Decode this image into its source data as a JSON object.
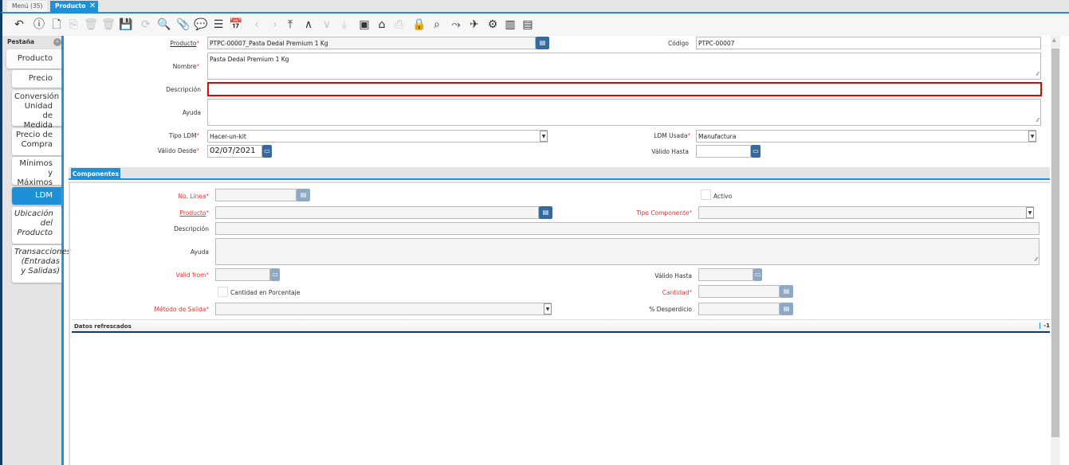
{
  "window_tabs": {
    "menu": "Menú (35)",
    "active": "Producto"
  },
  "toolbar": [
    "undo-icon",
    "help-icon",
    "new-record-icon",
    "copy-record-icon",
    "delete-icon",
    "delete-selection-icon",
    "save-icon",
    "refresh-icon",
    "find-icon",
    "attachment-icon",
    "chat-icon",
    "grid-toggle-icon",
    "calendar-icon",
    "previous-icon",
    "next-icon",
    "first-record-icon",
    "parent-record-icon",
    "detail-record-icon",
    "last-record-icon",
    "report-icon",
    "archive-icon",
    "print-icon",
    "lock-icon",
    "zoom-across-icon",
    "workflow-icon",
    "request-icon",
    "process-icon",
    "product-info-icon",
    "form-icon"
  ],
  "sidebar": {
    "title": "Pestaña",
    "tabs": [
      "Producto",
      "Precio",
      "Conversión Unidad de Medida",
      "Precio de Compra",
      "Mínimos y Máximos",
      "LDM",
      "Ubicación del Producto",
      "Transacciones (Entradas y Salidas)"
    ],
    "active": "LDM"
  },
  "header_form": {
    "producto": {
      "label": "Producto",
      "value": "PTPC-00007_Pasta Dedal Premium 1 Kg"
    },
    "codigo": {
      "label": "Código",
      "value": "PTPC-00007"
    },
    "nombre": {
      "label": "Nombre",
      "value": "Pasta Dedal Premium 1 Kg"
    },
    "descripcion": {
      "label": "Descripción",
      "value": ""
    },
    "ayuda": {
      "label": "Ayuda",
      "value": ""
    },
    "tipo_ldm": {
      "label": "Tipo LDM",
      "value": "Hacer-un-kit"
    },
    "ldm_usada": {
      "label": "LDM Usada",
      "value": "Manufactura"
    },
    "valido_desde": {
      "label": "Válido Desde",
      "value": "02/07/2021"
    },
    "valido_hasta": {
      "label": "Válido Hasta",
      "value": ""
    }
  },
  "subtab": {
    "label": "Componentes"
  },
  "components_form": {
    "no_linea": {
      "label": "No. Línea",
      "value": ""
    },
    "activo": {
      "label": "Activo",
      "checked": false
    },
    "producto": {
      "label": "Producto",
      "value": ""
    },
    "tipo_componente": {
      "label": "Tipo Componente",
      "value": ""
    },
    "descripcion": {
      "label": "Descripción",
      "value": ""
    },
    "ayuda": {
      "label": "Ayuda",
      "value": ""
    },
    "valid_from": {
      "label": "Valid from",
      "value": ""
    },
    "valido_hasta": {
      "label": "Válido Hasta",
      "value": ""
    },
    "cantidad_porcentaje": {
      "label": "Cantidad en Porcentaje",
      "checked": false
    },
    "cantidad": {
      "label": "Cantidad",
      "value": ""
    },
    "metodo_salida": {
      "label": "Método de Salida",
      "value": ""
    },
    "desperdicio": {
      "label": "% Desperdicio",
      "value": ""
    }
  },
  "status": {
    "message": "Datos refrescados",
    "record": "-1"
  }
}
